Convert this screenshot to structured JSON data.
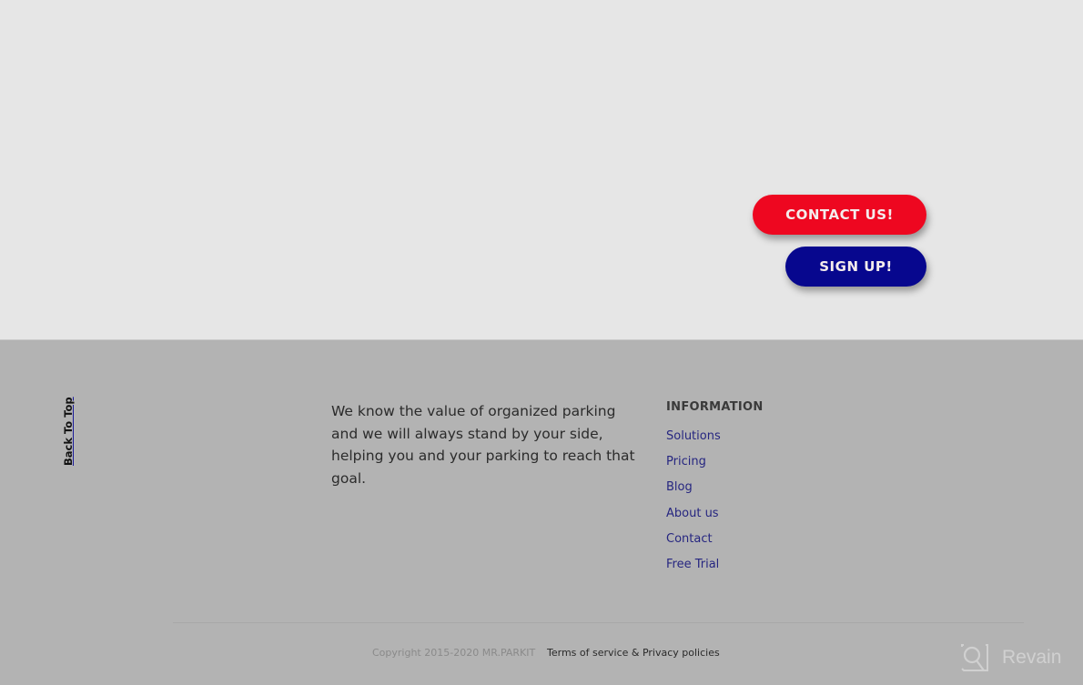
{
  "cta": {
    "contact_label": "CONTACT US!",
    "signup_label": "SIGN UP!",
    "contact_color": "#ee0720",
    "signup_color": "#07078e"
  },
  "footer": {
    "back_to_top": "Back To Top",
    "about_text": "We know the value of organized parking and we will always stand by your side, helping you and your parking to reach that goal.",
    "information": {
      "heading": "INFORMATION",
      "links": [
        "Solutions",
        "Pricing",
        "Blog",
        "About us",
        "Contact",
        "Free Trial"
      ]
    },
    "copyright": "Copyright 2015-2020 MR.PARKIT",
    "terms": "Terms of service & Privacy policies"
  },
  "watermark": {
    "icon": "revain-logo-icon",
    "text": "Revain"
  }
}
